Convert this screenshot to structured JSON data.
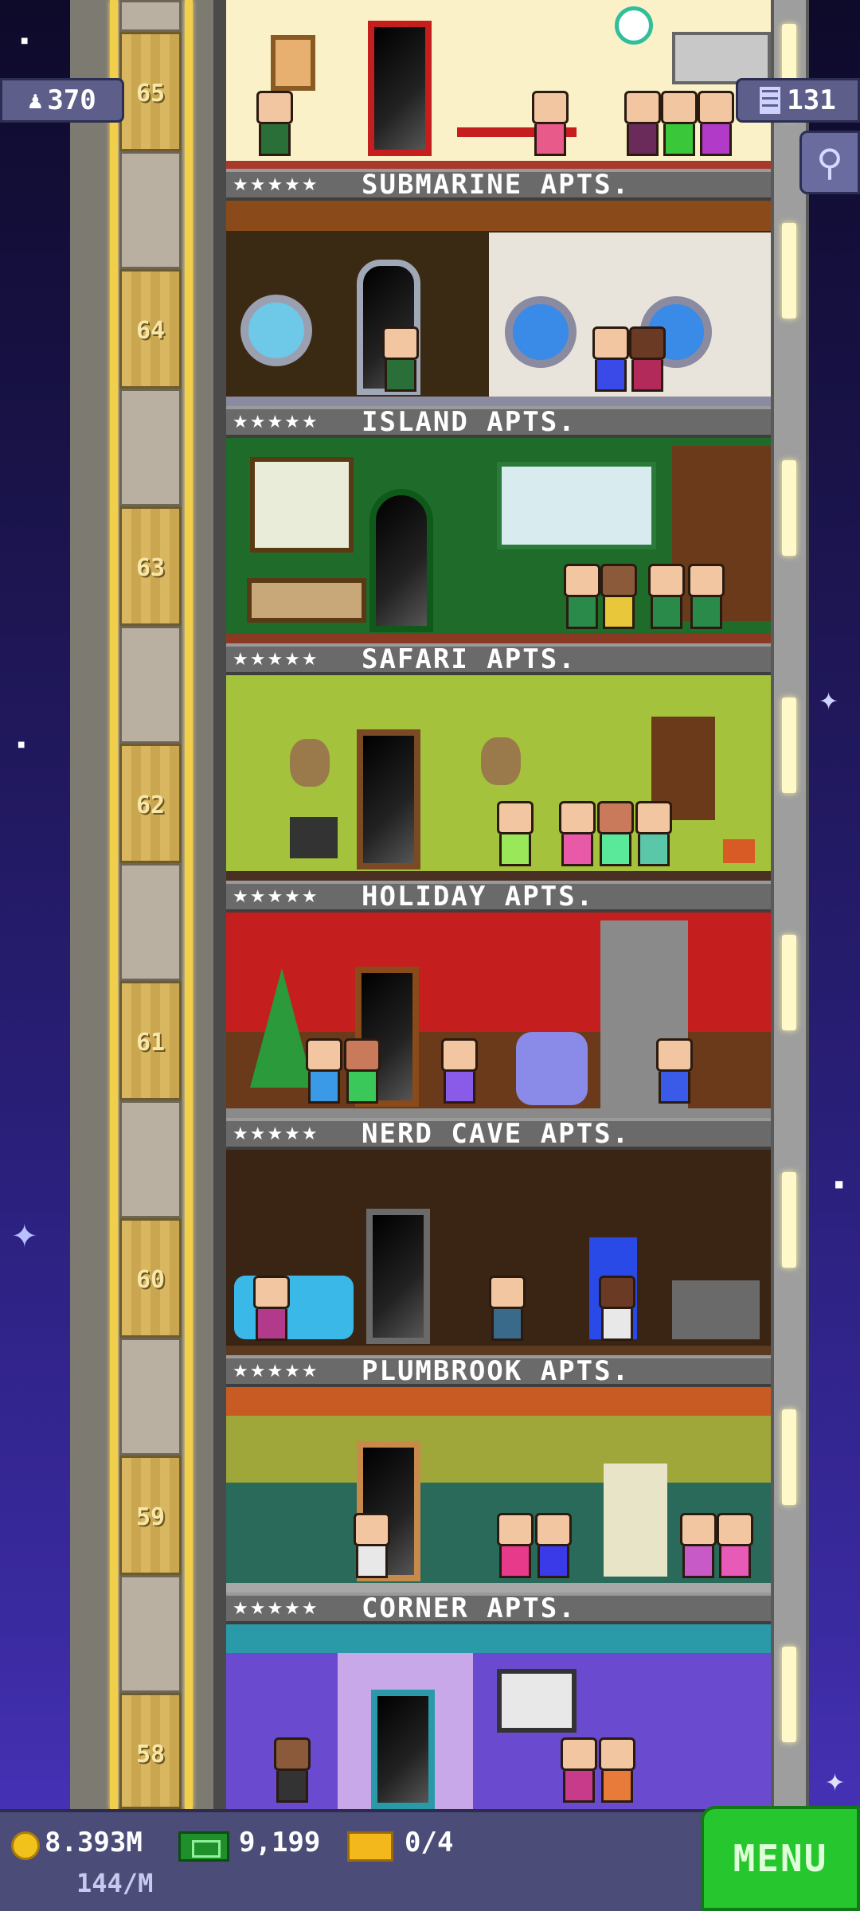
{
  "hud": {
    "population": "370",
    "floor_count": "131",
    "coins": "8.393M",
    "coin_rate": "144/M",
    "bux": "9,199",
    "tickets": "0/4",
    "menu_label": "MENU",
    "population_icon": "person-icon",
    "floors_icon": "building-icon",
    "search_icon": "magnifier-icon"
  },
  "floors": [
    {
      "number": "65",
      "name": "SUBMARINE APTS.",
      "stars": "★★★★★",
      "wall": "#fbf1c8",
      "floor_color": "#a83a2c"
    },
    {
      "number": "64",
      "name": "ISLAND APTS.",
      "stars": "★★★★★",
      "wall": "#f0eadb",
      "floor_color": "#8a8aa0"
    },
    {
      "number": "63",
      "name": "SAFARI APTS.",
      "stars": "★★★★★",
      "wall": "#1f6b2a",
      "floor_color": "#8a3a22"
    },
    {
      "number": "62",
      "name": "HOLIDAY APTS.",
      "stars": "★★★★★",
      "wall": "#a5c23c",
      "floor_color": "#4a3022"
    },
    {
      "number": "61",
      "name": "NERD CAVE APTS.",
      "stars": "★★★★★",
      "wall": "#c41e1e",
      "floor_color": "#8a8a8a"
    },
    {
      "number": "60",
      "name": "PLUMBROOK APTS.",
      "stars": "★★★★★",
      "wall": "#3a2414",
      "floor_color": "#5a3a20"
    },
    {
      "number": "59",
      "name": "CORNER APTS.",
      "stars": "★★★★★",
      "wall": "#9fa63a",
      "floor_color": "#a8a8a8"
    },
    {
      "number": "58",
      "name": "",
      "stars": "",
      "wall": "#6a4bd0",
      "floor_color": "#c8c8c8"
    }
  ]
}
